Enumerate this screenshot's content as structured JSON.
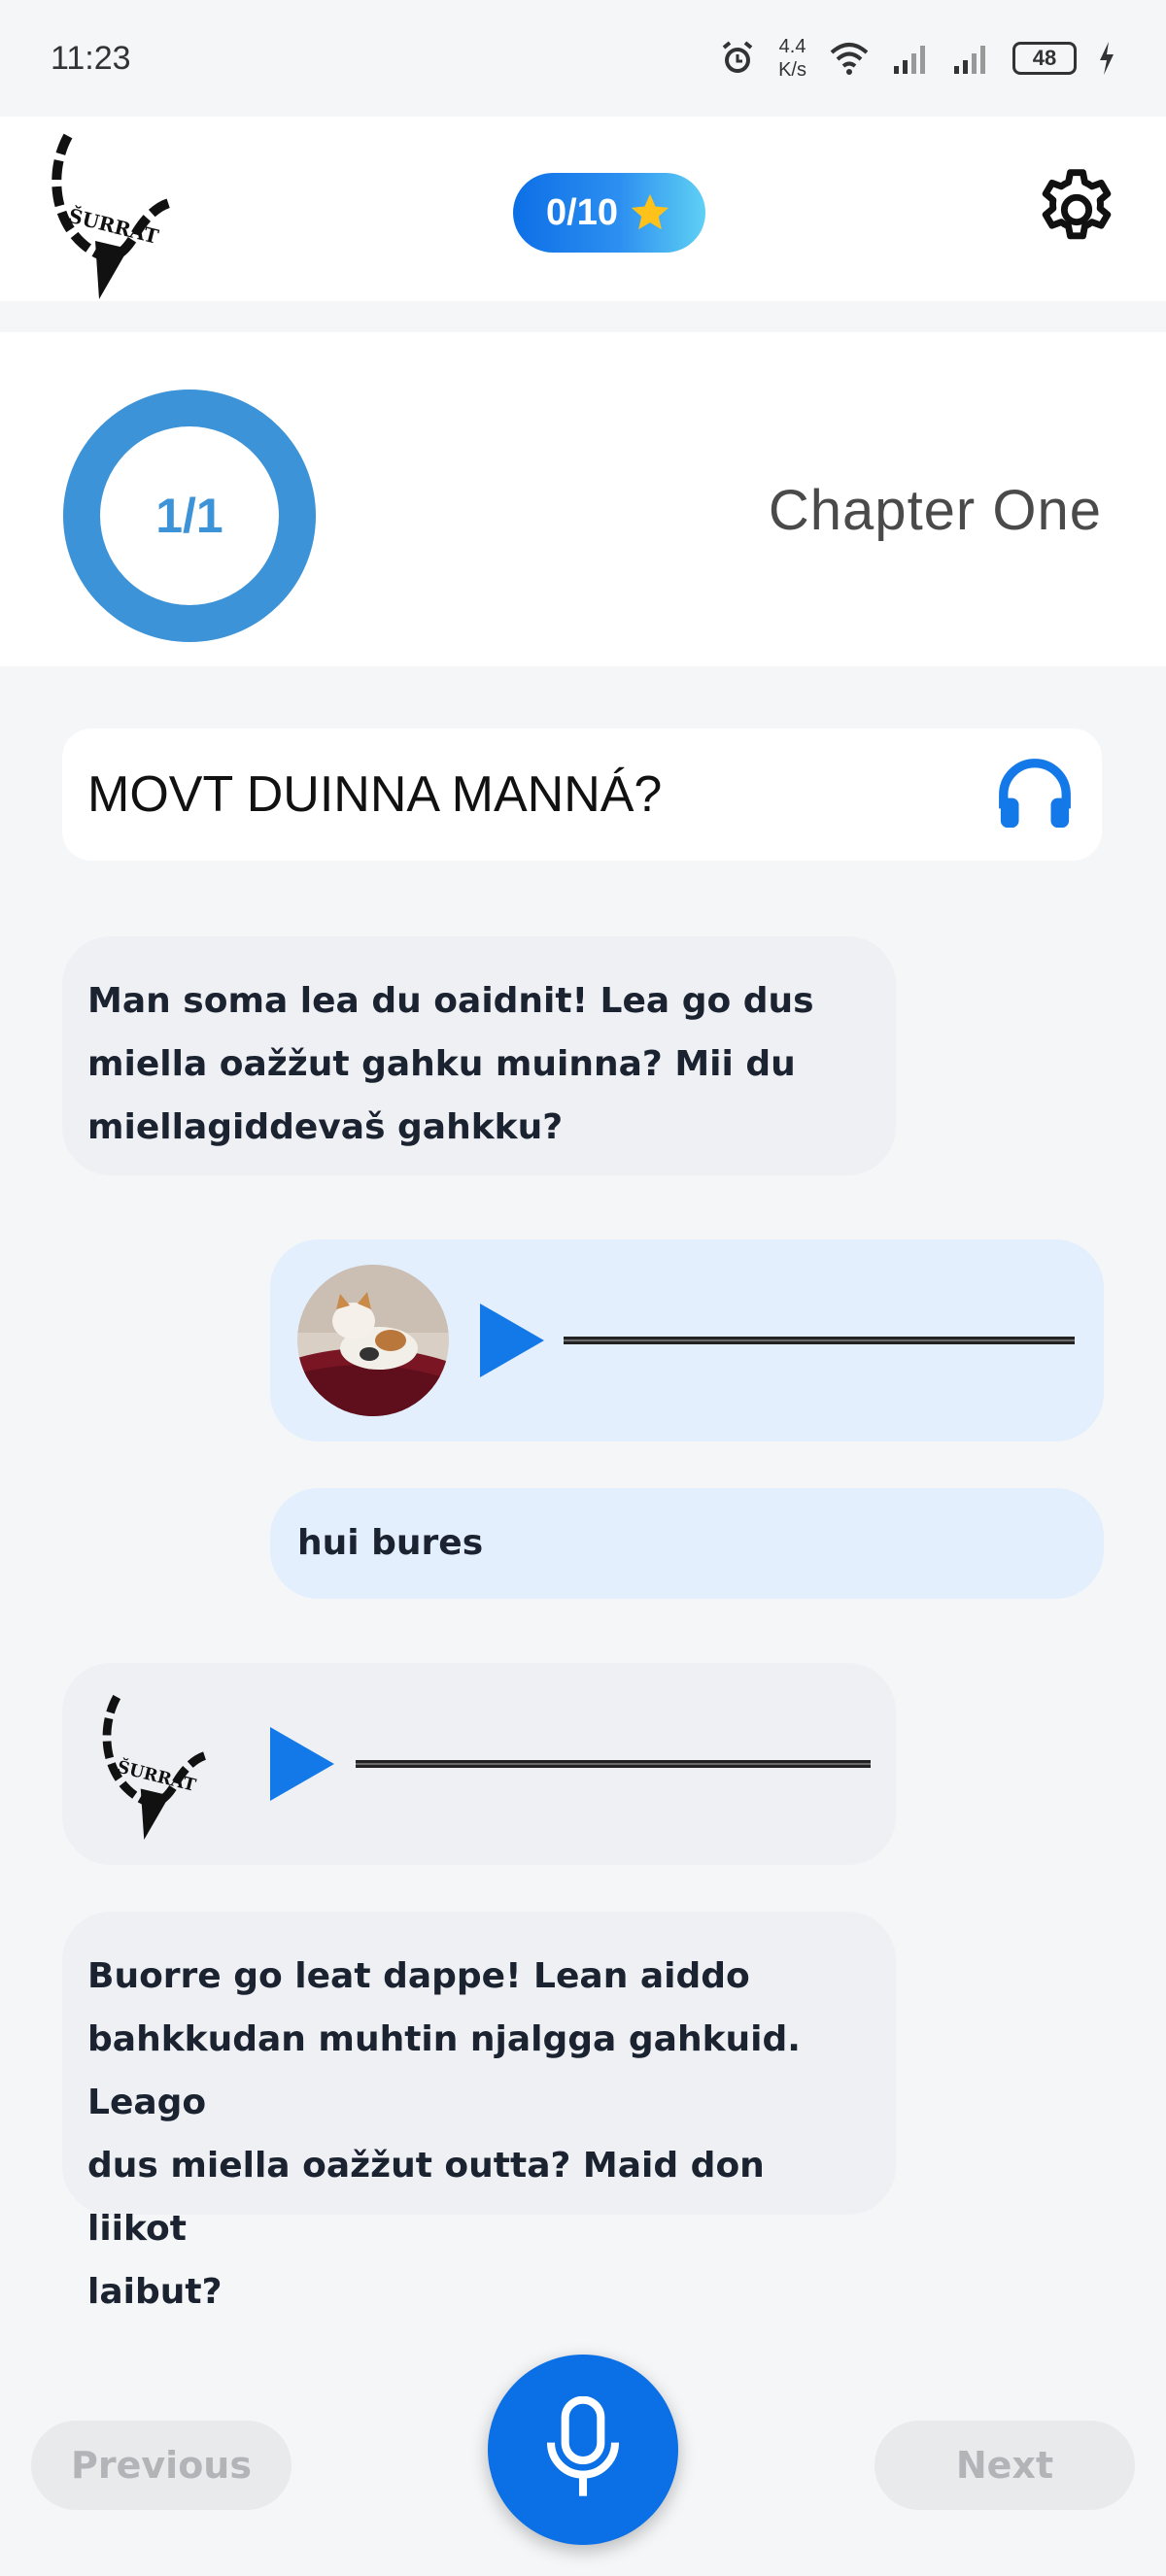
{
  "status_bar": {
    "time": "11:23",
    "net_speed_value": "4.4",
    "net_speed_unit": "K/s",
    "battery": "48"
  },
  "header": {
    "logo_text": "ŠURRAT",
    "score": "0/10",
    "icons": {
      "score": "star-icon",
      "settings": "gear-icon"
    }
  },
  "chapter": {
    "progress_label": "1/1",
    "progress_fraction": 1.0,
    "title": "Chapter One"
  },
  "question": {
    "text": "MOVT DUINNA MANNÁ?",
    "icon": "headphones-icon"
  },
  "messages": [
    {
      "sender": "bot",
      "type": "text",
      "lines": [
        "Man soma lea du oaidnit! Lea go dus",
        "miella oažžut gahku muinna? Mii du",
        "miellagiddevaš gahkku?"
      ]
    },
    {
      "sender": "user",
      "type": "audio"
    },
    {
      "sender": "user",
      "type": "text",
      "text": "hui bures"
    },
    {
      "sender": "bot",
      "type": "audio"
    },
    {
      "sender": "bot",
      "type": "text",
      "lines": [
        "Buorre go leat dappe! Lean aiddo",
        "bahkkudan muhtin njalgga gahkuid. Leago",
        "dus miella oažžut outta? Maid don liikot",
        "laibut?"
      ]
    }
  ],
  "nav": {
    "previous": "Previous",
    "next": "Next",
    "mic_icon": "microphone-icon"
  },
  "colors": {
    "primary": "#0b6fe5",
    "progress_ring": "#3c93d8",
    "bot_bubble": "#eef0f4",
    "user_bubble": "#e3effd",
    "disabled": "#e9eaec"
  }
}
